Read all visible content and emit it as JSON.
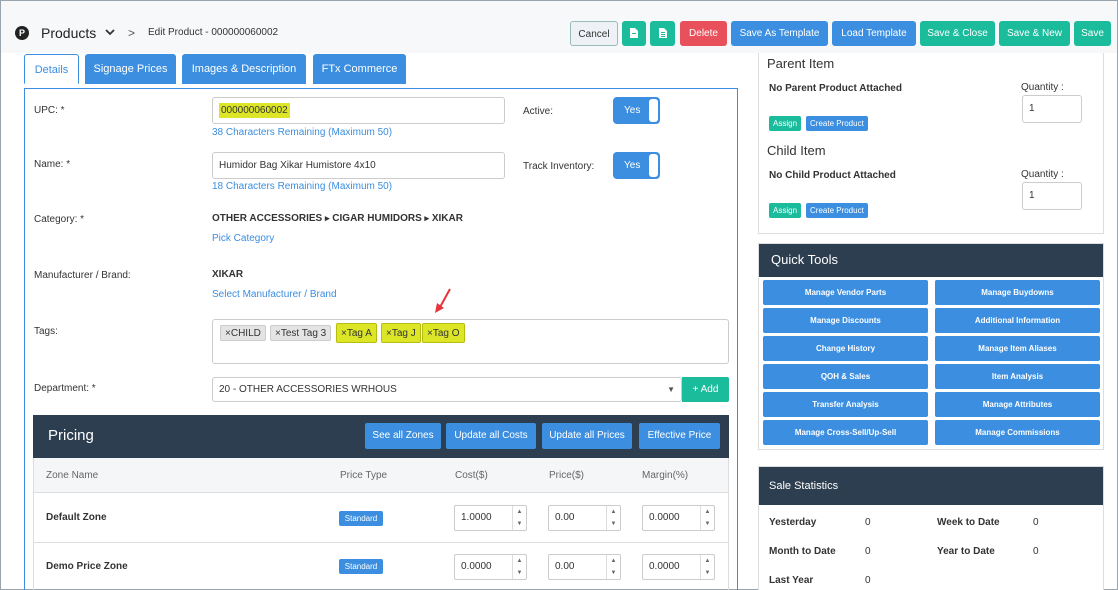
{
  "header": {
    "logo": "P",
    "title": "Products",
    "chevron": "⌄",
    "separator": ">",
    "breadcrumb": "Edit Product - 000000060002"
  },
  "toolbar": {
    "cancel": "Cancel",
    "delete": "Delete",
    "save_template": "Save As Template",
    "load_template": "Load Template",
    "save_close": "Save & Close",
    "save_new": "Save & New",
    "save": "Save"
  },
  "tabs": [
    "Details",
    "Signage Prices",
    "Images & Description",
    "FTx Commerce"
  ],
  "form": {
    "upc_label": "UPC: *",
    "upc_value": "000000060002",
    "upc_remaining": "38 Characters Remaining (Maximum 50)",
    "active_label": "Active:",
    "active_value": "Yes",
    "name_label": "Name: *",
    "name_value": "Humidor Bag Xikar Humistore 4x10",
    "name_remaining": "18 Characters Remaining (Maximum 50)",
    "track_label": "Track Inventory:",
    "track_value": "Yes",
    "category_label": "Category: *",
    "category_parts": [
      "OTHER ACCESSORIES",
      "CIGAR HUMIDORS",
      "XIKAR"
    ],
    "category_arrow": "▸",
    "pick_category": "Pick Category",
    "brand_label": "Manufacturer / Brand:",
    "brand_value": "XIKAR",
    "select_brand": "Select Manufacturer / Brand",
    "tags_label": "Tags:",
    "tags": [
      {
        "text": "CHILD",
        "highlight": false
      },
      {
        "text": "Test Tag 3",
        "highlight": false
      },
      {
        "text": "Tag A",
        "highlight": true
      },
      {
        "text": "Tag J",
        "highlight": true
      },
      {
        "text": "Tag O",
        "highlight": true
      }
    ],
    "tag_remove": "×",
    "department_label": "Department: *",
    "department_value": "20 - OTHER ACCESSORIES WRHOUS",
    "add_button": "+ Add"
  },
  "pricing": {
    "title": "Pricing",
    "buttons": [
      "See all Zones",
      "Update all Costs",
      "Update all Prices",
      "Effective Price"
    ],
    "columns": [
      "Zone Name",
      "Price Type",
      "Cost($)",
      "Price($)",
      "Margin(%)"
    ],
    "rows": [
      {
        "zone": "Default Zone",
        "type": "Standard",
        "cost": "1.0000",
        "price": "0.00",
        "margin": "0.0000"
      },
      {
        "zone": "Demo Price Zone",
        "type": "Standard",
        "cost": "0.0000",
        "price": "0.00",
        "margin": "0.0000"
      }
    ]
  },
  "parent": {
    "title": "Parent Item",
    "status": "No Parent Product Attached",
    "qty_label": "Quantity :",
    "qty_value": "1",
    "assign": "Assign",
    "create": "Create Product"
  },
  "child": {
    "title": "Child Item",
    "status": "No Child Product Attached",
    "qty_label": "Quantity :",
    "qty_value": "1",
    "assign": "Assign",
    "create": "Create Product"
  },
  "quick_tools": {
    "title": "Quick Tools",
    "items": [
      "Manage Vendor Parts",
      "Manage Buydowns",
      "Manage Discounts",
      "Additional Information",
      "Change History",
      "Manage Item Aliases",
      "QOH & Sales",
      "Item Analysis",
      "Transfer Analysis",
      "Manage Attributes",
      "Manage Cross-Sell/Up-Sell",
      "Manage Commissions"
    ]
  },
  "sales": {
    "title": "Sale Statistics",
    "stats": [
      {
        "label": "Yesterday",
        "value": "0"
      },
      {
        "label": "Week to Date",
        "value": "0"
      },
      {
        "label": "Month to Date",
        "value": "0"
      },
      {
        "label": "Year to Date",
        "value": "0"
      },
      {
        "label": "Last Year",
        "value": "0"
      }
    ]
  },
  "colors": {
    "primary": "#3b8ee0",
    "success": "#1abc9c",
    "danger": "#e8505b",
    "dark": "#2d3e50",
    "highlight": "#dce627"
  }
}
